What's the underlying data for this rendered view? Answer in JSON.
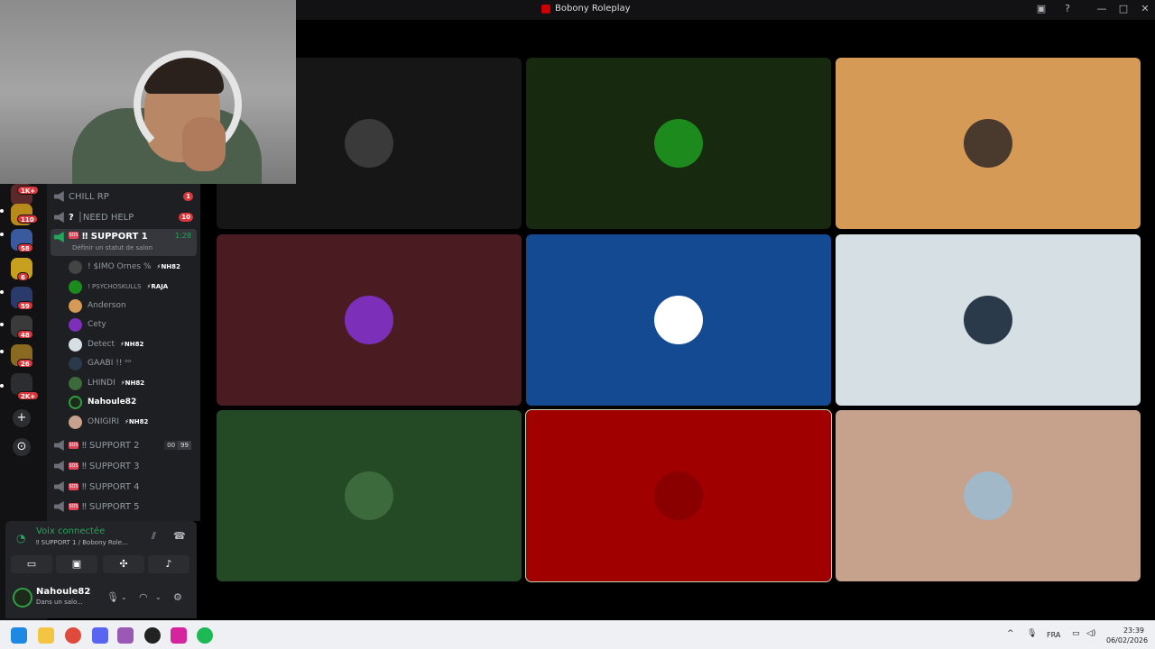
{
  "window": {
    "title": "Bobony Roleplay"
  },
  "servers": {
    "badges": [
      "1K+",
      "110",
      "58",
      "6",
      "59",
      "48",
      "26",
      "2K+"
    ]
  },
  "channels": {
    "chill": {
      "label": "CHILL RP",
      "badge": "1"
    },
    "needhelp": {
      "label": "│NEED HELP",
      "icon": "?",
      "badge": "10"
    },
    "support1": {
      "label": "‼ SUPPORT 1",
      "time": "1:28",
      "status": "Définir un statut de salon"
    },
    "support2": {
      "label": "‼ SUPPORT 2",
      "pair": [
        "00",
        "99"
      ]
    },
    "support3": {
      "label": "‼ SUPPORT 3"
    },
    "support4": {
      "label": "‼ SUPPORT 4"
    },
    "support5": {
      "label": "‼ SUPPORT 5"
    }
  },
  "members": [
    {
      "name": "! $IMO Ornes %",
      "tag": "⚡NH82"
    },
    {
      "name": "! PSYCHOSKULLS",
      "tag": "⚡RAJA"
    },
    {
      "name": "Anderson",
      "tag": ""
    },
    {
      "name": "Cety",
      "tag": ""
    },
    {
      "name": "Detect",
      "tag": "⚡NH82"
    },
    {
      "name": "GAABI !! ᵒᵒ",
      "tag": ""
    },
    {
      "name": "LHINDI",
      "tag": "⚡NH82"
    },
    {
      "name": "Nahoule82",
      "tag": ""
    },
    {
      "name": "ONIGIRI",
      "tag": "⚡NH82"
    }
  ],
  "voice": {
    "status": "Voix connectée",
    "channel": "‼ SUPPORT 1 / Bobony Role..."
  },
  "user": {
    "name": "Nahoule82",
    "status": "Dans un salo..."
  },
  "taskbar": {
    "lang": "FRA",
    "time": "23:39",
    "date": "06/02/2026"
  },
  "tiles": [
    {
      "bg": "#161616",
      "avatar": "#3a3a3a"
    },
    {
      "bg": "#17290f",
      "avatar": "#1c8a1c"
    },
    {
      "bg": "#d49a56",
      "avatar": "#4a3a2e"
    },
    {
      "bg": "#4a1c22",
      "avatar": "#7c2fb8"
    },
    {
      "bg": "#144a92",
      "avatar": "#ffffff"
    },
    {
      "bg": "#d6e0e4",
      "avatar": "#2a3a4a"
    },
    {
      "bg": "#244a25",
      "avatar": "#3c6a3c"
    },
    {
      "bg": "#a00000",
      "avatar": "#8a0000"
    },
    {
      "bg": "#c6a28c",
      "avatar": "#a0b8c8"
    }
  ]
}
